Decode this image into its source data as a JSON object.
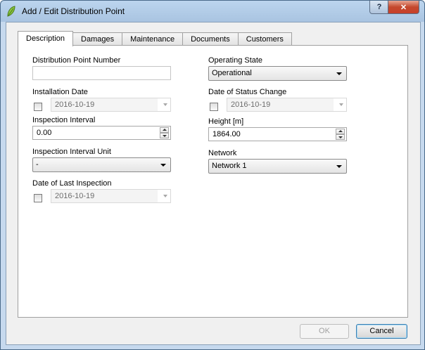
{
  "window": {
    "title": "Add / Edit Distribution Point",
    "help_glyph": "?",
    "close_glyph": "✕"
  },
  "tabs": [
    "Description",
    "Damages",
    "Maintenance",
    "Documents",
    "Customers"
  ],
  "active_tab": "Description",
  "form": {
    "dp_number": {
      "label": "Distribution Point Number",
      "value": ""
    },
    "installation_date": {
      "label": "Installation Date",
      "value": "2016-10-19",
      "checked": false
    },
    "inspection_interval": {
      "label": "Inspection Interval",
      "value": "0.00"
    },
    "inspection_interval_unit": {
      "label": "Inspection Interval Unit",
      "value": "-"
    },
    "last_inspection_date": {
      "label": "Date of Last Inspection",
      "value": "2016-10-19",
      "checked": false
    },
    "operating_state": {
      "label": "Operating State",
      "value": "Operational"
    },
    "status_change_date": {
      "label": "Date of Status Change",
      "value": "2016-10-19",
      "checked": false
    },
    "height": {
      "label": "Height [m]",
      "value": "1864.00"
    },
    "network": {
      "label": "Network",
      "value": "Network 1"
    }
  },
  "buttons": {
    "ok": "OK",
    "cancel": "Cancel"
  },
  "colors": {
    "title_bar": "#a9c4e1",
    "close_button": "#c7402a",
    "default_button_border": "#3c7fb1"
  }
}
